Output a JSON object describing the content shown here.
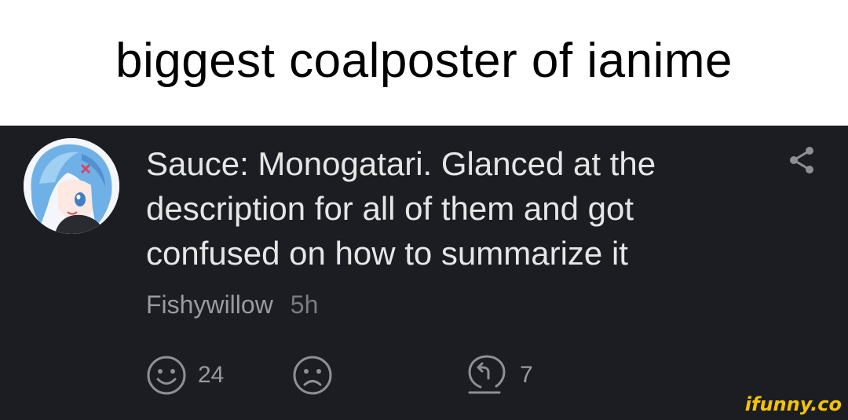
{
  "caption": {
    "text": "biggest coalposter of ianime"
  },
  "comment": {
    "text": "Sauce: Monogatari. Glanced at the description for all of them and got confused on how to summarize it",
    "author": "Fishywillow",
    "time": "5h",
    "smile_count": "24",
    "reply_count": "7"
  },
  "icons": {
    "share": "share-icon",
    "smile": "smile-icon",
    "frown": "frown-icon",
    "reply": "reply-icon"
  },
  "watermark": {
    "text": "ifunny.co"
  },
  "colors": {
    "comment_background": "#1c1d22",
    "comment_text": "#e6e6e6",
    "meta_text": "#9a9ba1",
    "icon_gray": "#8e8f95",
    "watermark": "#f5c400"
  }
}
